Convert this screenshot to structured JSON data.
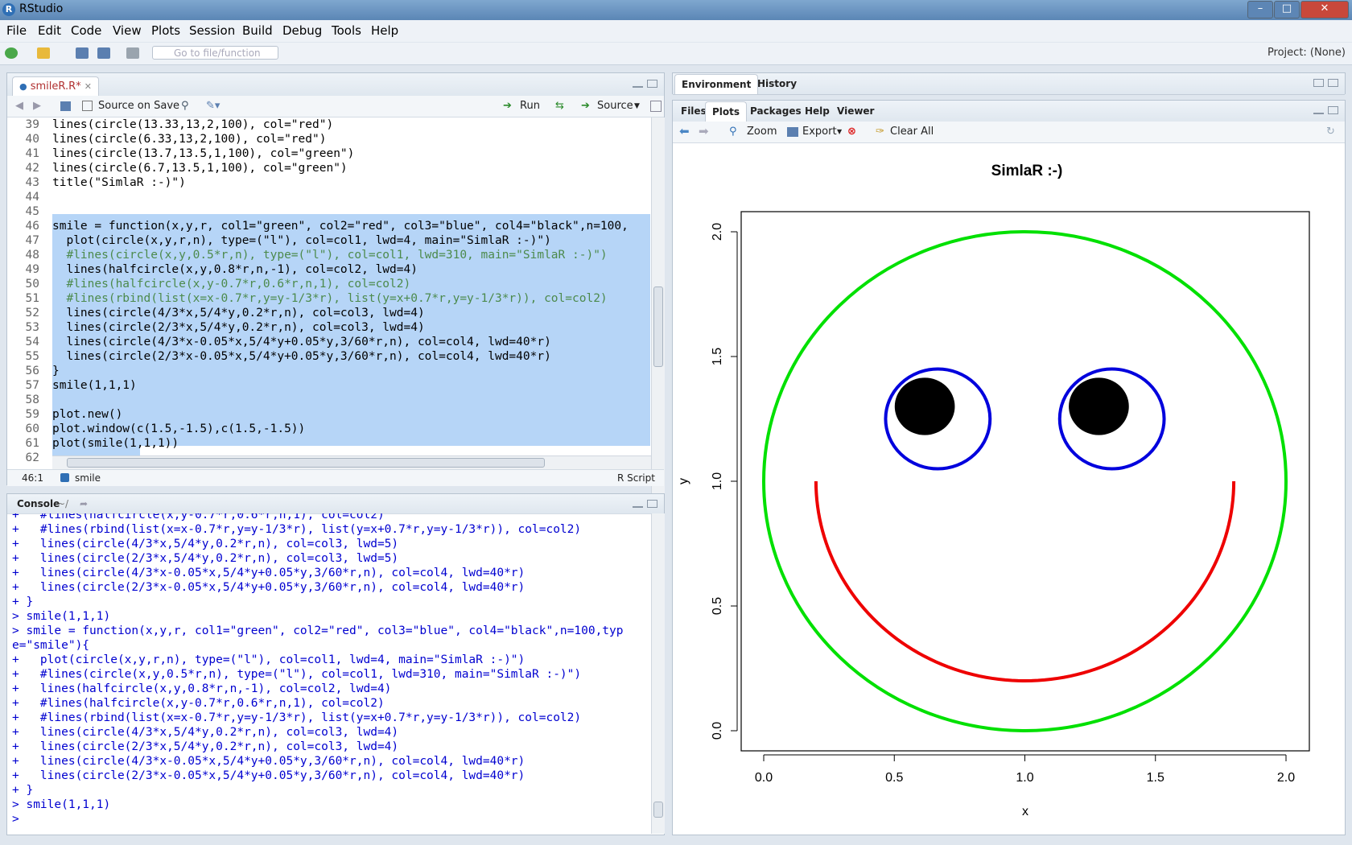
{
  "window": {
    "title": "RStudio",
    "minimize": "–",
    "maximize": "□",
    "close": "✕"
  },
  "menu": [
    "File",
    "Edit",
    "Code",
    "View",
    "Plots",
    "Session",
    "Build",
    "Debug",
    "Tools",
    "Help"
  ],
  "toolbar": {
    "goto_placeholder": "Go to file/function",
    "project": "Project: (None)"
  },
  "editor": {
    "tab_label": "smileR.R*",
    "source_on_save": "Source on Save",
    "run": "Run",
    "source": "Source",
    "lines": [
      {
        "n": "39",
        "t": "lines(circle(13.33,13,2,100), col=\"red\")"
      },
      {
        "n": "40",
        "t": "lines(circle(6.33,13,2,100), col=\"red\")"
      },
      {
        "n": "41",
        "t": "lines(circle(13.7,13.5,1,100), col=\"green\")"
      },
      {
        "n": "42",
        "t": "lines(circle(6.7,13.5,1,100), col=\"green\")"
      },
      {
        "n": "43",
        "t": "title(\"SimlaR :-)\")"
      },
      {
        "n": "44",
        "t": ""
      },
      {
        "n": "45",
        "t": ""
      },
      {
        "n": "46",
        "t": "smile = function(x,y,r, col1=\"green\", col2=\"red\", col3=\"blue\", col4=\"black\",n=100,"
      },
      {
        "n": "47",
        "t": "  plot(circle(x,y,r,n), type=(\"l\"), col=col1, lwd=4, main=\"SimlaR :-)\")"
      },
      {
        "n": "48",
        "t": "  #lines(circle(x,y,0.5*r,n), type=(\"l\"), col=col1, lwd=310, main=\"SimlaR :-)\")"
      },
      {
        "n": "49",
        "t": "  lines(halfcircle(x,y,0.8*r,n,-1), col=col2, lwd=4)"
      },
      {
        "n": "50",
        "t": "  #lines(halfcircle(x,y-0.7*r,0.6*r,n,1), col=col2)"
      },
      {
        "n": "51",
        "t": "  #lines(rbind(list(x=x-0.7*r,y=y-1/3*r), list(y=x+0.7*r,y=y-1/3*r)), col=col2)"
      },
      {
        "n": "52",
        "t": "  lines(circle(4/3*x,5/4*y,0.2*r,n), col=col3, lwd=4)"
      },
      {
        "n": "53",
        "t": "  lines(circle(2/3*x,5/4*y,0.2*r,n), col=col3, lwd=4)"
      },
      {
        "n": "54",
        "t": "  lines(circle(4/3*x-0.05*x,5/4*y+0.05*y,3/60*r,n), col=col4, lwd=40*r)"
      },
      {
        "n": "55",
        "t": "  lines(circle(2/3*x-0.05*x,5/4*y+0.05*y,3/60*r,n), col=col4, lwd=40*r)"
      },
      {
        "n": "56",
        "t": "}"
      },
      {
        "n": "57",
        "t": "smile(1,1,1)"
      },
      {
        "n": "58",
        "t": ""
      },
      {
        "n": "59",
        "t": "plot.new()"
      },
      {
        "n": "60",
        "t": "plot.window(c(1.5,-1.5),c(1.5,-1.5))"
      },
      {
        "n": "61",
        "t": "plot(smile(1,1,1))"
      },
      {
        "n": "62",
        "t": ""
      }
    ],
    "status_pos": "46:1",
    "status_fn": "smile",
    "status_type": "R Script"
  },
  "console": {
    "title": "Console",
    "path": "~/",
    "lines": [
      "+   #lines(halfcircle(x,y-0.7*r,0.6*r,n,1), col=col2)",
      "+   #lines(rbind(list(x=x-0.7*r,y=y-1/3*r), list(y=x+0.7*r,y=y-1/3*r)), col=col2)",
      "+   lines(circle(4/3*x,5/4*y,0.2*r,n), col=col3, lwd=5)",
      "+   lines(circle(2/3*x,5/4*y,0.2*r,n), col=col3, lwd=5)",
      "+   lines(circle(4/3*x-0.05*x,5/4*y+0.05*y,3/60*r,n), col=col4, lwd=40*r)",
      "+   lines(circle(2/3*x-0.05*x,5/4*y+0.05*y,3/60*r,n), col=col4, lwd=40*r)",
      "+ }",
      "> smile(1,1,1)",
      "> smile = function(x,y,r, col1=\"green\", col2=\"red\", col3=\"blue\", col4=\"black\",n=100,typ",
      "e=\"smile\"){",
      "+   plot(circle(x,y,r,n), type=(\"l\"), col=col1, lwd=4, main=\"SimlaR :-)\")",
      "+   #lines(circle(x,y,0.5*r,n), type=(\"l\"), col=col1, lwd=310, main=\"SimlaR :-)\")",
      "+   lines(halfcircle(x,y,0.8*r,n,-1), col=col2, lwd=4)",
      "+   #lines(halfcircle(x,y-0.7*r,0.6*r,n,1), col=col2)",
      "+   #lines(rbind(list(x=x-0.7*r,y=y-1/3*r), list(y=x+0.7*r,y=y-1/3*r)), col=col2)",
      "+   lines(circle(4/3*x,5/4*y,0.2*r,n), col=col3, lwd=4)",
      "+   lines(circle(2/3*x,5/4*y,0.2*r,n), col=col3, lwd=4)",
      "+   lines(circle(4/3*x-0.05*x,5/4*y+0.05*y,3/60*r,n), col=col4, lwd=40*r)",
      "+   lines(circle(2/3*x-0.05*x,5/4*y+0.05*y,3/60*r,n), col=col4, lwd=40*r)",
      "+ }",
      "> smile(1,1,1)",
      "> "
    ]
  },
  "env_pane": {
    "tabs": [
      "Environment",
      "History"
    ]
  },
  "files_pane": {
    "tabs": [
      "Files",
      "Plots",
      "Packages",
      "Help",
      "Viewer"
    ],
    "active_tab": "Plots",
    "zoom": "Zoom",
    "export": "Export",
    "clear_all": "Clear All"
  },
  "chart_data": {
    "type": "line",
    "title": "SimlaR :-)",
    "xlabel": "x",
    "ylabel": "y",
    "xlim": [
      0,
      2
    ],
    "ylim": [
      0,
      2
    ],
    "xticks": [
      "0.0",
      "0.5",
      "1.0",
      "1.5",
      "2.0"
    ],
    "yticks": [
      "0.0",
      "0.5",
      "1.0",
      "1.5",
      "2.0"
    ],
    "series": [
      {
        "kind": "circle",
        "cx": 1,
        "cy": 1,
        "r": 1,
        "color": "#00e000",
        "lwd": 4
      },
      {
        "kind": "lower-half-circle",
        "cx": 1,
        "cy": 1,
        "r": 0.8,
        "color": "#ee0000",
        "lwd": 4
      },
      {
        "kind": "circle",
        "cx": 1.3333,
        "cy": 1.25,
        "r": 0.2,
        "color": "#0000dd",
        "lwd": 4
      },
      {
        "kind": "circle",
        "cx": 0.6667,
        "cy": 1.25,
        "r": 0.2,
        "color": "#0000dd",
        "lwd": 4
      },
      {
        "kind": "filled-circle",
        "cx": 1.2833,
        "cy": 1.3,
        "r": 0.115,
        "color": "#000000"
      },
      {
        "kind": "filled-circle",
        "cx": 0.6167,
        "cy": 1.3,
        "r": 0.115,
        "color": "#000000"
      }
    ]
  }
}
